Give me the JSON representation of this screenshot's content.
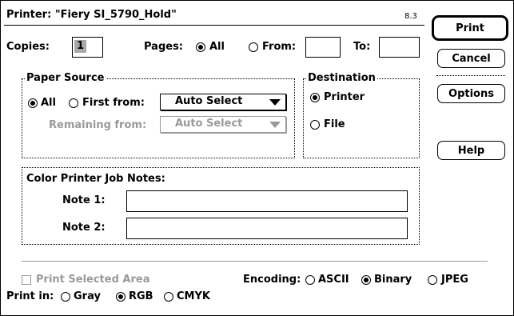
{
  "header": {
    "printer_label": "Printer: \"Fiery SI_5790_Hold\"",
    "version": "8.3"
  },
  "copies": {
    "label": "Copies:",
    "value": "1"
  },
  "pages": {
    "label": "Pages:",
    "all_label": "All",
    "from_label": "From:",
    "to_label": "To:",
    "from_value": "",
    "to_value": ""
  },
  "buttons": {
    "print": "Print",
    "cancel": "Cancel",
    "options": "Options",
    "help": "Help"
  },
  "paper_source": {
    "title": "Paper Source",
    "all_label": "All",
    "first_from_label": "First from:",
    "first_from_value": "Auto Select",
    "remaining_from_label": "Remaining from:",
    "remaining_from_value": "Auto Select"
  },
  "destination": {
    "title": "Destination",
    "printer_label": "Printer",
    "file_label": "File"
  },
  "job_notes": {
    "title": "Color Printer Job Notes:",
    "note1_label": "Note 1:",
    "note2_label": "Note 2:",
    "note1_value": "",
    "note2_value": ""
  },
  "bottom": {
    "print_selected_label": "Print Selected Area",
    "encoding_label": "Encoding:",
    "encoding_options": [
      "ASCII",
      "Binary",
      "JPEG"
    ],
    "encoding_selected": "Binary",
    "print_in_label": "Print in:",
    "print_in_options": [
      "Gray",
      "RGB",
      "CMYK"
    ],
    "print_in_selected": "RGB"
  }
}
